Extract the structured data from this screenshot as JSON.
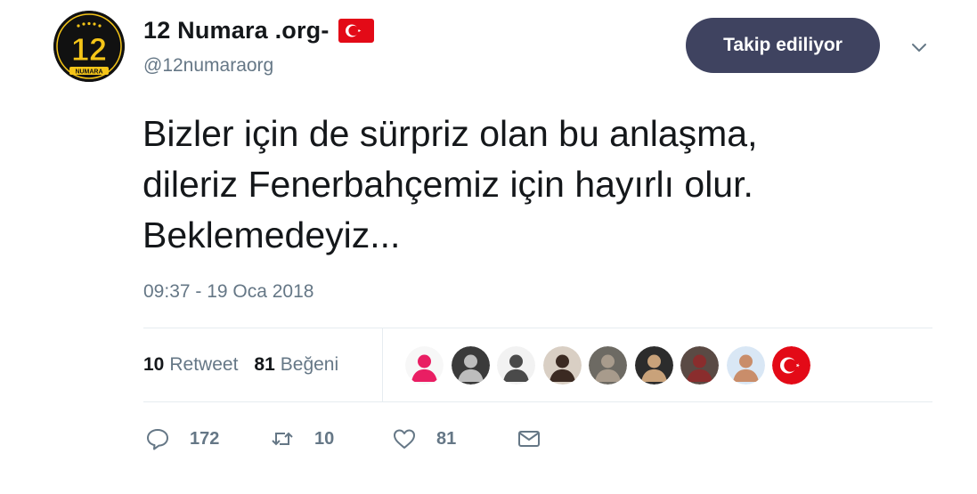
{
  "tweet": {
    "display_name": "12 Numara .org-",
    "handle": "@12numaraorg",
    "avatar": {
      "icon": "team-logo-12-numara",
      "text": "12",
      "caption": "NUMARA"
    },
    "name_emoji": "turkey-flag-emoji",
    "follow_label": "Takip ediliyor",
    "text": "Bizler için de sürpriz olan bu anlaşma,\ndileriz Fenerbahçemiz için hayırlı olur.\nBeklemedeyiz...",
    "timestamp": "09:37 - 19 Oca 2018",
    "stats": {
      "retweet_count": "10",
      "retweet_label": "Retweet",
      "like_count": "81",
      "like_label": "Beğeni"
    },
    "likers": [
      {
        "icon": "avatar-photo",
        "colors": [
          "#f7f7f7",
          "#e91e63"
        ]
      },
      {
        "icon": "avatar-photo",
        "colors": [
          "#3a3a3a",
          "#bdbdbd"
        ]
      },
      {
        "icon": "avatar-photo",
        "colors": [
          "#f2f2f2",
          "#4a4a4a"
        ]
      },
      {
        "icon": "avatar-photo",
        "colors": [
          "#d9cfc4",
          "#3b2a22"
        ]
      },
      {
        "icon": "avatar-photo",
        "colors": [
          "#6d6a63",
          "#a89b8c"
        ]
      },
      {
        "icon": "avatar-photo",
        "colors": [
          "#2c2c2c",
          "#c9a27a"
        ]
      },
      {
        "icon": "avatar-photo",
        "colors": [
          "#5a4a44",
          "#8a2d2d"
        ]
      },
      {
        "icon": "avatar-photo",
        "colors": [
          "#d9e7f5",
          "#c98d6a"
        ]
      },
      {
        "icon": "turkey-flag-avatar",
        "colors": [
          "#e30a17",
          "#ffffff"
        ]
      }
    ],
    "actions": {
      "reply_count": "172",
      "retweet_count": "10",
      "like_count": "81"
    }
  },
  "colors": {
    "follow_button_bg": "#3f4360",
    "secondary_text": "#657786",
    "divider": "#e6ecf0",
    "turkey_red": "#e30a17"
  }
}
